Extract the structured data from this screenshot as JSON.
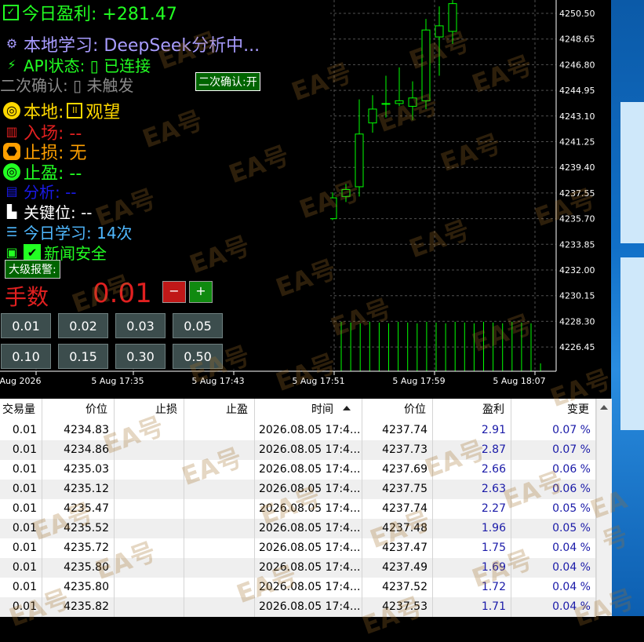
{
  "panel": {
    "today_profit": "今日盈利: +281.47",
    "learning": "本地学习: DeepSeek分析中...",
    "api_status": "API状态: ▯ 已连接",
    "second_confirm": "二次确认: ▯ 未触发",
    "second_confirm_btn": "二次确认:开",
    "local": "本地:",
    "local_state": "观望",
    "entry": "入场: --",
    "stop_loss": "止损: 无",
    "take_profit": "止盈: --",
    "analysis": "分析: --",
    "key_level": "关键位: --",
    "today_learn": "今日学习: 14次",
    "news": "新闻安全",
    "alarm_btn": "大级报警:",
    "lots_label": "手数",
    "lots_value": "0.01",
    "minus": "−",
    "plus": "+",
    "lot_buttons": [
      "0.01",
      "0.02",
      "0.03",
      "0.05",
      "0.10",
      "0.15",
      "0.30",
      "0.50"
    ]
  },
  "chart": {
    "price_ticks": [
      "4250.50",
      "4248.65",
      "4246.80",
      "4244.95",
      "4243.10",
      "4241.25",
      "4239.40",
      "4237.55",
      "4235.70",
      "4233.85",
      "4232.00",
      "4230.15",
      "4228.30",
      "4226.45"
    ],
    "time_ticks": [
      "Aug 2026",
      "5 Aug 17:35",
      "5 Aug 17:43",
      "5 Aug 17:51",
      "5 Aug 17:59",
      "5 Aug 18:07"
    ],
    "candles": [
      {
        "o": 4235.7,
        "h": 4237.6,
        "l": 4235.6,
        "c": 4237.2
      },
      {
        "o": 4237.3,
        "h": 4238.2,
        "l": 4236.9,
        "c": 4237.8
      },
      {
        "o": 4238.0,
        "h": 4244.3,
        "l": 4237.3,
        "c": 4241.8
      },
      {
        "o": 4242.6,
        "h": 4244.6,
        "l": 4241.9,
        "c": 4243.6
      },
      {
        "o": 4244.0,
        "h": 4246.0,
        "l": 4243.0,
        "c": 4244.0
      },
      {
        "o": 4244.2,
        "h": 4246.6,
        "l": 4243.8,
        "c": 4244.0
      },
      {
        "o": 4243.8,
        "h": 4245.6,
        "l": 4242.8,
        "c": 4244.4
      },
      {
        "o": 4244.2,
        "h": 4250.1,
        "l": 4243.6,
        "c": 4249.3
      },
      {
        "o": 4248.8,
        "h": 4251.0,
        "l": 4246.0,
        "c": 4249.6
      },
      {
        "o": 4249.2,
        "h": 4251.5,
        "l": 4248.3,
        "c": 4251.2
      }
    ],
    "colors": {
      "bull": "#00ff00",
      "grid": "#505050",
      "frame": "#ffffff",
      "text": "#ffffff"
    }
  },
  "table": {
    "headers": [
      "交易量",
      "价位",
      "止损",
      "止盈",
      "时间",
      "价位",
      "盈利",
      "变更"
    ],
    "rows": [
      [
        "0.01",
        "4234.83",
        "",
        "",
        "2026.08.05 17:4...",
        "4237.74",
        "2.91",
        "0.07 %"
      ],
      [
        "0.01",
        "4234.86",
        "",
        "",
        "2026.08.05 17:4...",
        "4237.73",
        "2.87",
        "0.07 %"
      ],
      [
        "0.01",
        "4235.03",
        "",
        "",
        "2026.08.05 17:4...",
        "4237.69",
        "2.66",
        "0.06 %"
      ],
      [
        "0.01",
        "4235.12",
        "",
        "",
        "2026.08.05 17:4...",
        "4237.75",
        "2.63",
        "0.06 %"
      ],
      [
        "0.01",
        "4235.47",
        "",
        "",
        "2026.08.05 17:4...",
        "4237.74",
        "2.27",
        "0.05 %"
      ],
      [
        "0.01",
        "4235.52",
        "",
        "",
        "2026.08.05 17:4...",
        "4237.48",
        "1.96",
        "0.05 %"
      ],
      [
        "0.01",
        "4235.72",
        "",
        "",
        "2026.08.05 17:4...",
        "4237.47",
        "1.75",
        "0.04 %"
      ],
      [
        "0.01",
        "4235.80",
        "",
        "",
        "2026.08.05 17:4...",
        "4237.49",
        "1.69",
        "0.04 %"
      ],
      [
        "0.01",
        "4235.80",
        "",
        "",
        "2026.08.05 17:4...",
        "4237.52",
        "1.72",
        "0.04 %"
      ],
      [
        "0.01",
        "4235.82",
        "",
        "",
        "2026.08.05 17:4...",
        "4237.53",
        "1.71",
        "0.04 %"
      ]
    ]
  },
  "watermark": "EA号"
}
